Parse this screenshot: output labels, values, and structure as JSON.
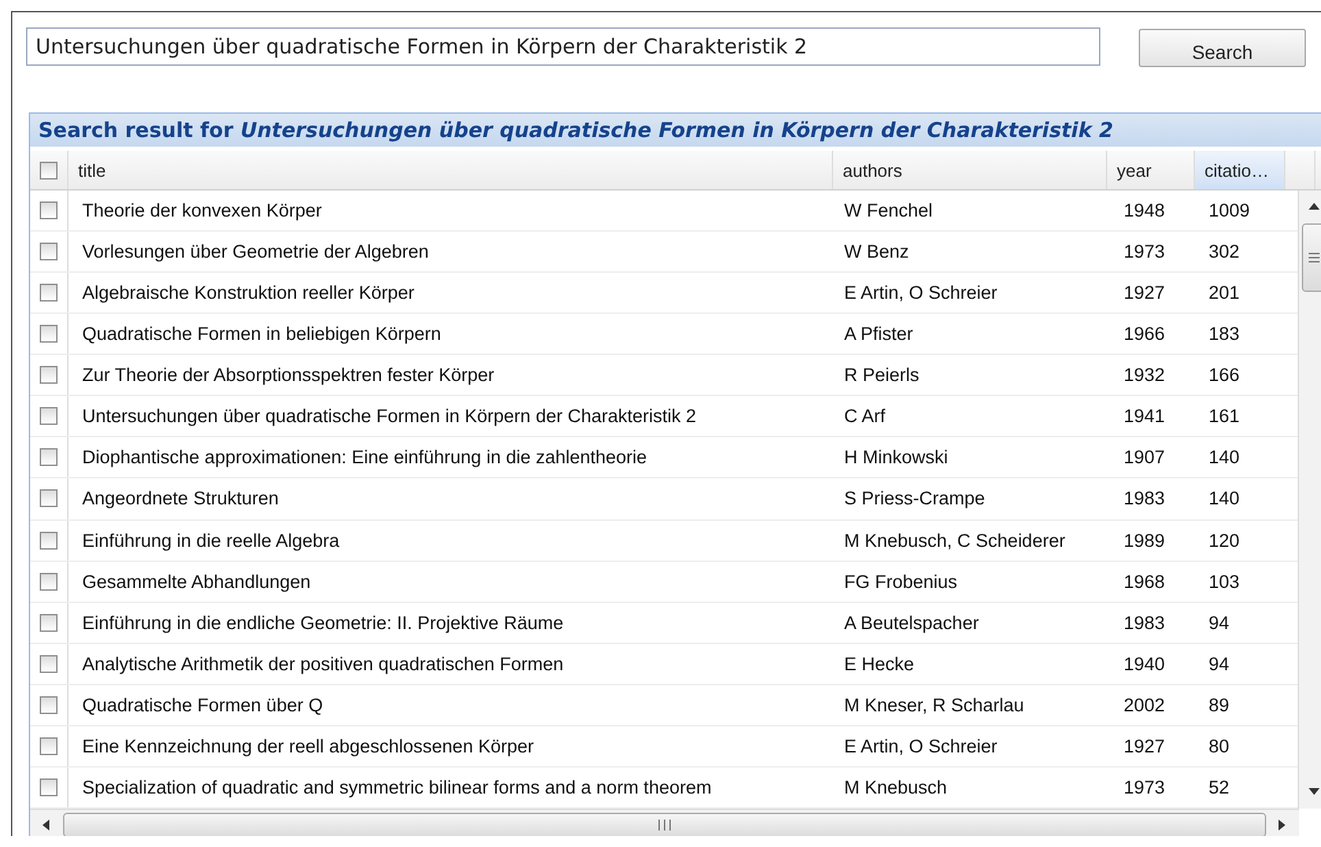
{
  "search": {
    "value": "Untersuchungen über quadratische Formen in Körpern der Charakteristik 2",
    "button": "Search"
  },
  "results": {
    "heading": "Search result for *Untersuchungen über quadratische Formen in Körpern der Charakteristik 2*",
    "select_all": {
      "checked": false
    },
    "columns": [
      {
        "label": "title",
        "selected": false
      },
      {
        "label": "authors",
        "selected": false
      },
      {
        "label": "year",
        "selected": false
      },
      {
        "label": "citatio…",
        "selected": true
      }
    ],
    "rows": [
      {
        "checked": false,
        "title": "Theorie der konvexen Körper",
        "authors": "W Fenchel",
        "year": "1948",
        "citations": "1009"
      },
      {
        "checked": false,
        "title": "Vorlesungen über Geometrie der Algebren",
        "authors": "W Benz",
        "year": "1973",
        "citations": "302"
      },
      {
        "checked": false,
        "title": "Algebraische Konstruktion reeller Körper",
        "authors": "E Artin, O Schreier",
        "year": "1927",
        "citations": "201"
      },
      {
        "checked": false,
        "title": "Quadratische Formen in beliebigen Körpern",
        "authors": "A Pfister",
        "year": "1966",
        "citations": "183"
      },
      {
        "checked": false,
        "title": "Zur Theorie der Absorptionsspektren fester Körper",
        "authors": "R Peierls",
        "year": "1932",
        "citations": "166"
      },
      {
        "checked": false,
        "title": "Untersuchungen über quadratische Formen in Körpern der Charakteristik 2",
        "authors": "C Arf",
        "year": "1941",
        "citations": "161"
      },
      {
        "checked": false,
        "title": "Diophantische approximationen: Eine einführung in die zahlentheorie",
        "authors": "H Minkowski",
        "year": "1907",
        "citations": "140"
      },
      {
        "checked": false,
        "title": "Angeordnete Strukturen",
        "authors": "S Priess-Crampe",
        "year": "1983",
        "citations": "140"
      },
      {
        "checked": false,
        "title": "Einführung in die reelle Algebra",
        "authors": "M Knebusch, C Scheiderer",
        "year": "1989",
        "citations": "120"
      },
      {
        "checked": false,
        "title": "Gesammelte Abhandlungen",
        "authors": "FG Frobenius",
        "year": "1968",
        "citations": "103"
      },
      {
        "checked": false,
        "title": "Einführung in die endliche Geometrie: II. Projektive Räume",
        "authors": "A Beutelspacher",
        "year": "1983",
        "citations": "94"
      },
      {
        "checked": false,
        "title": "Analytische Arithmetik der positiven quadratischen Formen",
        "authors": "E Hecke",
        "year": "1940",
        "citations": "94"
      },
      {
        "checked": false,
        "title": "Quadratische Formen über Q",
        "authors": "M Kneser, R Scharlau",
        "year": "2002",
        "citations": "89"
      },
      {
        "checked": false,
        "title": "Eine Kennzeichnung der reell abgeschlossenen Körper",
        "authors": "E Artin, O Schreier",
        "year": "1927",
        "citations": "80"
      },
      {
        "checked": false,
        "title": "Specialization of quadratic and symmetric bilinear forms and a norm theorem",
        "authors": "M Knebusch",
        "year": "1973",
        "citations": "52"
      }
    ]
  }
}
